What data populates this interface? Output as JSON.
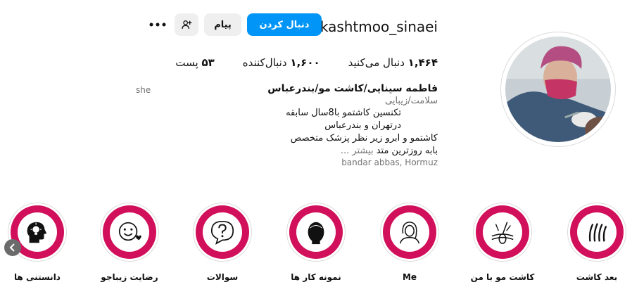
{
  "profile": {
    "username": "kashtmoo_sinaei",
    "follow_label": "دنبال کردن",
    "message_label": "پیام",
    "posts_count": "۵۳",
    "posts_label": "پست",
    "followers_count": "۱,۶۰۰",
    "followers_label": "دنبال‌کننده",
    "following_count": "۱,۴۶۴",
    "following_label": "دنبال می‌کنید",
    "full_name": "فاطمه سینایی/کاشت مو/بندرعباس",
    "pronoun": "she",
    "category": "سلامت/زیبایی",
    "bio_lines": [
      "تکنسین کاشتمو با8سال سابقه",
      "درتهران و بندرعباس",
      "کاشتمو و ابرو زیر نظر پزشک متخصص",
      "بابه روزترین متد"
    ],
    "more_label": "بیشتر ...",
    "location": "bandar abbas, Hormuz"
  },
  "highlights": [
    {
      "label": "بعد کاشت",
      "icon": "hair-strands-icon"
    },
    {
      "label": "کاشت مو با من",
      "icon": "hair-follicle-icon"
    },
    {
      "label": "Me",
      "icon": "woman-icon"
    },
    {
      "label": "نمونه کار ها",
      "icon": "head-icon"
    },
    {
      "label": "سوالات",
      "icon": "question-bubble-icon"
    },
    {
      "label": "رضایت زیباجو",
      "icon": "smile-heart-icon"
    },
    {
      "label": "دانستنی ها",
      "icon": "brain-bulb-icon"
    }
  ],
  "colors": {
    "follow_button": "#0095f6",
    "highlight_ring": "#d10f5a",
    "secondary_button": "#efefef",
    "muted_text": "#737373"
  }
}
